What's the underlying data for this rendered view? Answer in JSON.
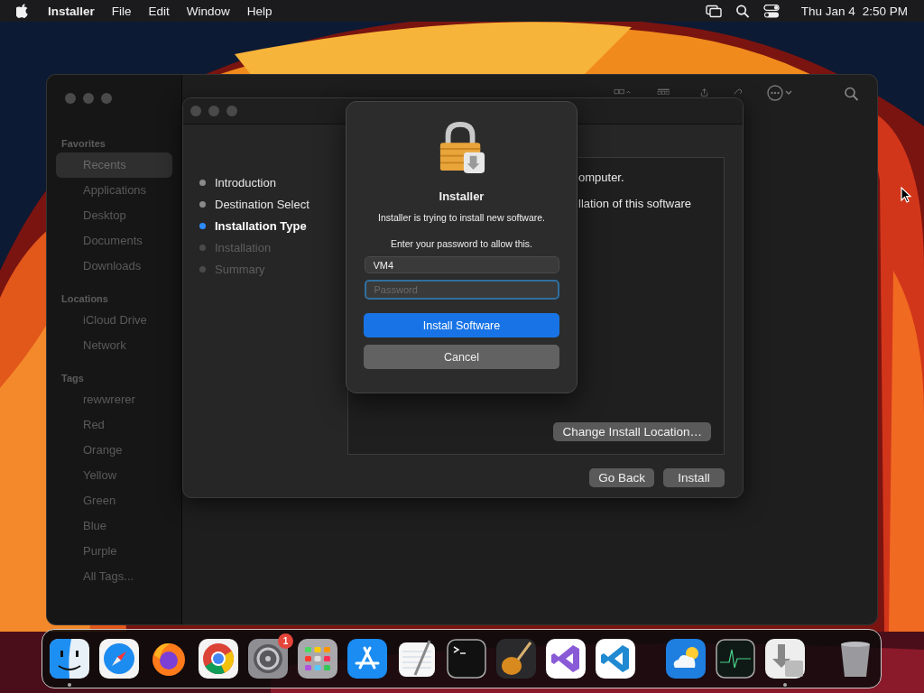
{
  "menu_bar": {
    "app_name": "Installer",
    "menus": [
      "File",
      "Edit",
      "Window",
      "Help"
    ],
    "date": "Thu Jan 4",
    "time": "2:50 PM"
  },
  "finder": {
    "sections": [
      {
        "heading": "Favorites",
        "items": [
          {
            "label": "Recents",
            "selected": true
          },
          {
            "label": "Applications",
            "selected": false
          },
          {
            "label": "Desktop",
            "selected": false
          },
          {
            "label": "Documents",
            "selected": false
          },
          {
            "label": "Downloads",
            "selected": false
          }
        ]
      },
      {
        "heading": "Locations",
        "items": [
          {
            "label": "iCloud Drive",
            "selected": false
          },
          {
            "label": "Network",
            "selected": false
          }
        ]
      },
      {
        "heading": "Tags",
        "items": [
          {
            "label": "rewwrerer",
            "selected": false
          },
          {
            "label": "Red",
            "selected": false
          },
          {
            "label": "Orange",
            "selected": false
          },
          {
            "label": "Yellow",
            "selected": false
          },
          {
            "label": "Green",
            "selected": false
          },
          {
            "label": "Blue",
            "selected": false
          },
          {
            "label": "Purple",
            "selected": false
          },
          {
            "label": "All Tags...",
            "selected": false
          }
        ]
      }
    ]
  },
  "installer": {
    "steps": [
      {
        "label": "Introduction",
        "done": true,
        "selected": false
      },
      {
        "label": "Destination Select",
        "done": true,
        "selected": false
      },
      {
        "label": "Installation Type",
        "done": false,
        "selected": true
      },
      {
        "label": "Installation",
        "done": false,
        "selected": false
      },
      {
        "label": "Summary",
        "done": false,
        "selected": false
      }
    ],
    "content_lines": [
      "omputer.",
      "llation of this software"
    ],
    "change_location_button": "Change Install Location…",
    "buttons": [
      "Go Back",
      "Install"
    ]
  },
  "dialog": {
    "title": "Installer",
    "message": "Installer is trying to install new software.",
    "prompt": "Enter your password to allow this.",
    "username": {
      "value": "VM4"
    },
    "password": {
      "placeholder": "Password",
      "focused": true
    },
    "primary_button": "Install Software",
    "cancel_button": "Cancel"
  },
  "dock": {
    "items": [
      {
        "kind": "finder",
        "running": true
      },
      {
        "kind": "compass",
        "running": false
      },
      {
        "kind": "fox",
        "running": false
      },
      {
        "kind": "wheel",
        "running": false
      },
      {
        "kind": "gear",
        "running": false,
        "badge": "1"
      },
      {
        "kind": "grid",
        "running": false
      },
      {
        "kind": "store",
        "running": false
      },
      {
        "kind": "notepad",
        "running": false
      },
      {
        "kind": "terminal",
        "running": false
      },
      {
        "kind": "guitar",
        "running": false
      },
      {
        "kind": "studio",
        "running": false
      },
      {
        "kind": "code",
        "running": false
      },
      {
        "kind": "separator"
      },
      {
        "kind": "weather",
        "running": false
      },
      {
        "kind": "monitor",
        "running": false
      },
      {
        "kind": "installer",
        "running": true
      },
      {
        "kind": "separator"
      },
      {
        "kind": "trash",
        "running": false
      }
    ]
  }
}
